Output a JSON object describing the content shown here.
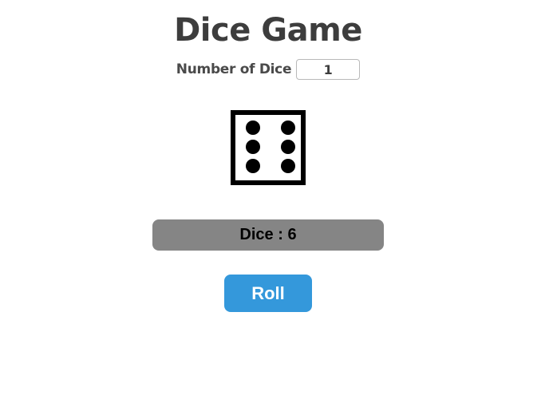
{
  "app": {
    "title": "Dice Game"
  },
  "controls": {
    "number_of_dice_label": "Number of Dice",
    "number_of_dice_value": "1"
  },
  "dice": {
    "faces": [
      6
    ]
  },
  "result": {
    "text": "Dice : 6"
  },
  "actions": {
    "roll_label": "Roll"
  },
  "colors": {
    "title": "#3d3d3d",
    "result_bar": "#858585",
    "roll_button": "#3498db",
    "roll_text": "#ffffff",
    "pip": "#000000"
  }
}
